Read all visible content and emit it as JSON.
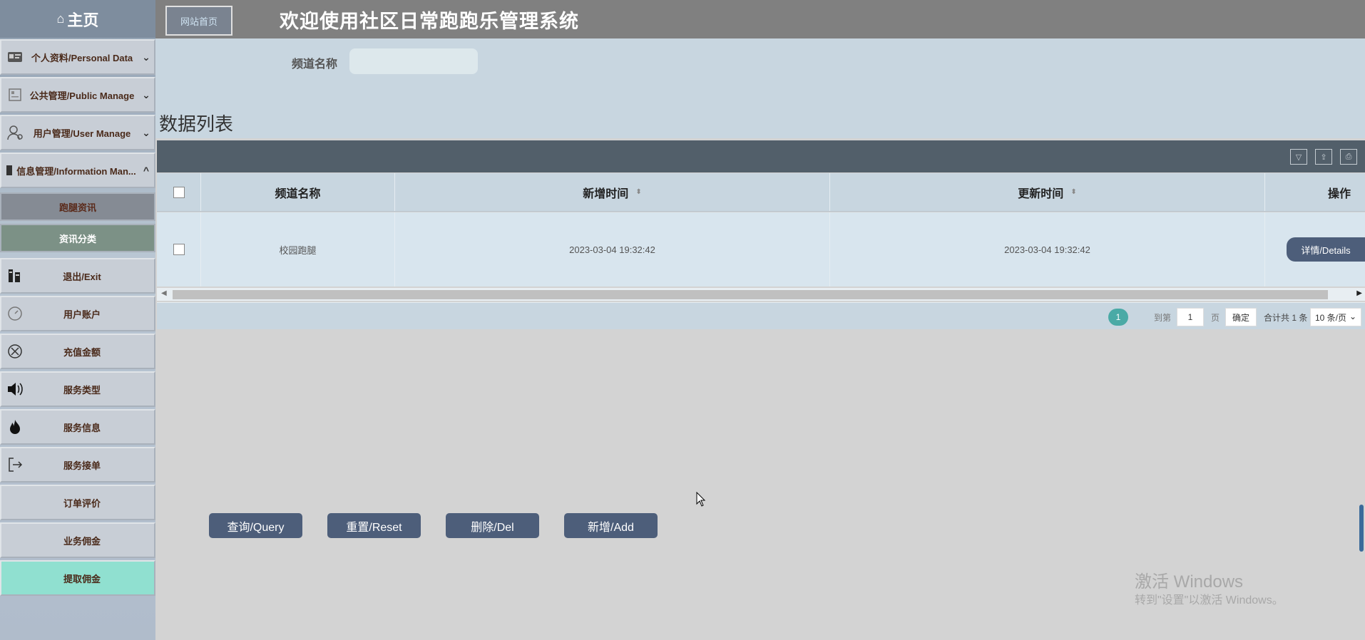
{
  "sidebar": {
    "home": "主页",
    "items": [
      {
        "label": "个人资料/Personal Data",
        "icon": "id-card-icon"
      },
      {
        "label": "公共管理/Public Manage",
        "icon": "document-icon"
      },
      {
        "label": "用户管理/User Manage",
        "icon": "user-gear-icon"
      },
      {
        "label": "信息管理/Information Man...",
        "icon": "building-icon"
      }
    ],
    "subitems": [
      {
        "label": "跑腿资讯",
        "color": "#858b94"
      },
      {
        "label": "资讯分类",
        "color": "#7c9186"
      }
    ],
    "items2": [
      {
        "label": "退出/Exit",
        "icon": "books-icon"
      },
      {
        "label": "用户账户",
        "icon": "speed-icon"
      },
      {
        "label": "充值金额",
        "icon": "crosshair-icon"
      },
      {
        "label": "服务类型",
        "icon": "speaker-icon"
      },
      {
        "label": "服务信息",
        "icon": "fire-icon"
      },
      {
        "label": "服务接单",
        "icon": "logout-icon"
      },
      {
        "label": "订单评价",
        "icon": ""
      },
      {
        "label": "业务佣金",
        "icon": ""
      },
      {
        "label": "提取佣金",
        "icon": "",
        "active_color": "#90e0d0"
      }
    ]
  },
  "topbar": {
    "site_home": "网站首页",
    "title": "欢迎使用社区日常跑跑乐管理系统"
  },
  "search": {
    "label": "频道名称",
    "value": ""
  },
  "list": {
    "title": "数据列表",
    "columns": [
      "频道名称",
      "新增时间",
      "更新时间",
      "操作"
    ],
    "rows": [
      {
        "name": "校园跑腿",
        "created": "2023-03-04 19:32:42",
        "updated": "2023-03-04 19:32:42",
        "action": "详情/Details"
      }
    ]
  },
  "pager": {
    "current": "1",
    "goto_label": "到第",
    "goto_value": "1",
    "page_unit": "页",
    "confirm": "确定",
    "total": "合计共 1 条",
    "page_size": "10 条/页"
  },
  "actions": {
    "query": "查询/Query",
    "reset": "重置/Reset",
    "delete": "删除/Del",
    "add": "新增/Add"
  },
  "watermark": {
    "line1": "激活 Windows",
    "line2": "转到\"设置\"以激活 Windows。"
  }
}
